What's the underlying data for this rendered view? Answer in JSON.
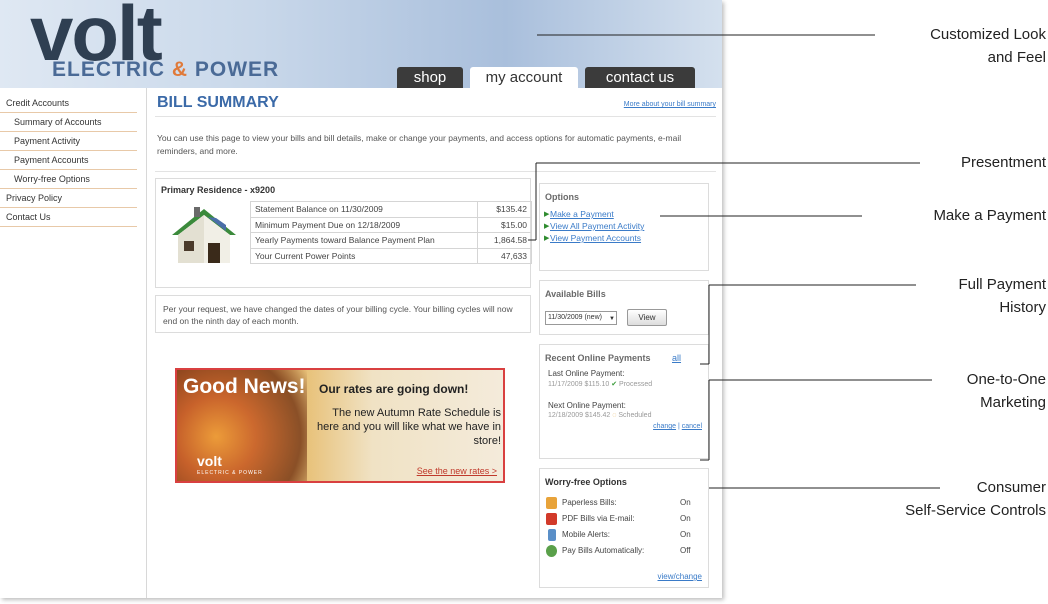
{
  "header": {
    "logo_main": "volt",
    "logo_sub_1": "ELECTRIC",
    "logo_sub_amp": "&",
    "logo_sub_2": "POWER",
    "tabs": [
      {
        "label": "shop"
      },
      {
        "label": "my account"
      },
      {
        "label": "contact us"
      }
    ]
  },
  "sidebar": {
    "items": [
      {
        "label": "Credit Accounts"
      },
      {
        "label": "Summary of Accounts"
      },
      {
        "label": "Payment Activity"
      },
      {
        "label": "Payment Accounts"
      },
      {
        "label": "Worry-free Options"
      },
      {
        "label": "Privacy Policy"
      },
      {
        "label": "Contact Us"
      }
    ]
  },
  "main": {
    "title": "BILL SUMMARY",
    "more_link": "More about your bill summary",
    "intro": "You can use this page to view your bills and bill details, make or change your payments, and access options for automatic payments, e-mail reminders, and more.",
    "primary": {
      "title": "Primary Residence - x9200",
      "rows": [
        {
          "label": "Statement Balance on 11/30/2009",
          "value": "$135.42"
        },
        {
          "label": "Minimum Payment Due on 12/18/2009",
          "value": "$15.00"
        },
        {
          "label": "Yearly Payments toward Balance Payment Plan",
          "value": "1,864.58"
        },
        {
          "label": "Your Current Power Points",
          "value": "47,633"
        }
      ]
    },
    "notice": "Per your request, we have changed the dates of your billing cycle. Your billing cycles will now end on the ninth day of each month.",
    "promo": {
      "good_news": "Good News!",
      "headline": "Our rates are going down!",
      "body": "The new Autumn Rate Schedule is here and you will like what we have in store!",
      "link": "See the new rates >",
      "logo": "volt",
      "logo_sub": "ELECTRIC & POWER"
    },
    "options": {
      "title": "Options",
      "links": [
        {
          "label": "Make a Payment"
        },
        {
          "label": "View All Payment Activity"
        },
        {
          "label": "View Payment Accounts"
        }
      ]
    },
    "bills": {
      "title": "Available Bills",
      "selected": "11/30/2009 (new)",
      "view_button": "View"
    },
    "recent": {
      "title": "Recent Online Payments",
      "all_link": "all",
      "last_label": "Last Online Payment:",
      "last_date": "11/17/2009",
      "last_amount": "$115.10",
      "last_status": "Processed",
      "next_label": "Next Online Payment:",
      "next_date": "12/18/2009",
      "next_amount": "$145.42",
      "next_status": "Scheduled",
      "change_link": "change",
      "separator": "|",
      "cancel_link": "cancel"
    },
    "worry": {
      "title": "Worry-free Options",
      "rows": [
        {
          "label": "Paperless Bills:",
          "value": "On",
          "icon": "paperless-icon",
          "color": "#e8a33a"
        },
        {
          "label": "PDF Bills via E-mail:",
          "value": "On",
          "icon": "pdf-icon",
          "color": "#d23a2a"
        },
        {
          "label": "Mobile Alerts:",
          "value": "On",
          "icon": "mobile-icon",
          "color": "#5a8fc8"
        },
        {
          "label": "Pay Bills Automatically:",
          "value": "Off",
          "icon": "money-icon",
          "color": "#5aa04a"
        }
      ],
      "link": "view/change"
    }
  },
  "callouts": [
    {
      "line1": "Customized Look",
      "line2": "and Feel"
    },
    {
      "line1": "Presentment",
      "line2": ""
    },
    {
      "line1": "Make a Payment",
      "line2": ""
    },
    {
      "line1": "Full Payment",
      "line2": "History"
    },
    {
      "line1": "One-to-One",
      "line2": "Marketing"
    },
    {
      "line1": "Consumer",
      "line2": "Self-Service Controls"
    }
  ],
  "colors": {
    "accent_blue": "#3b6aa8",
    "link_blue": "#3a7bc8",
    "promo_border": "#d94040",
    "tab_dark": "#3b3b3b"
  }
}
